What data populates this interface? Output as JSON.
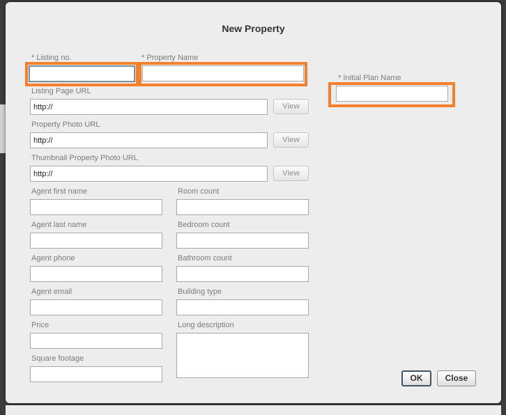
{
  "dialog": {
    "title": "New Property"
  },
  "fields": {
    "listing_no": {
      "label": "* Listing no.",
      "value": ""
    },
    "property_name": {
      "label": "* Property Name",
      "value": ""
    },
    "initial_plan_name": {
      "label": "* Initial Plan Name",
      "value": ""
    },
    "listing_page_url": {
      "label": "Listing Page URL",
      "value": "http://"
    },
    "property_photo_url": {
      "label": "Property Photo URL",
      "value": "http://"
    },
    "thumbnail_photo_url": {
      "label": "Thumbnail Property Photo URL",
      "value": "http://"
    },
    "agent_first_name": {
      "label": "Agent first name",
      "value": ""
    },
    "agent_last_name": {
      "label": "Agent last name",
      "value": ""
    },
    "agent_phone": {
      "label": "Agent phone",
      "value": ""
    },
    "agent_email": {
      "label": "Agent email",
      "value": ""
    },
    "price": {
      "label": "Price",
      "value": ""
    },
    "square_footage": {
      "label": "Square footage",
      "value": ""
    },
    "room_count": {
      "label": "Room count",
      "value": ""
    },
    "bedroom_count": {
      "label": "Bedroom count",
      "value": ""
    },
    "bathroom_count": {
      "label": "Bathroom count",
      "value": ""
    },
    "building_type": {
      "label": "Building type",
      "value": ""
    },
    "long_description": {
      "label": "Long description",
      "value": ""
    }
  },
  "buttons": {
    "view_label": "View",
    "ok_label": "OK",
    "close_label": "Close"
  },
  "colors": {
    "highlight": "#f57f2a",
    "dialog_bg": "#ededed",
    "overlay": "#3c3c3c"
  }
}
